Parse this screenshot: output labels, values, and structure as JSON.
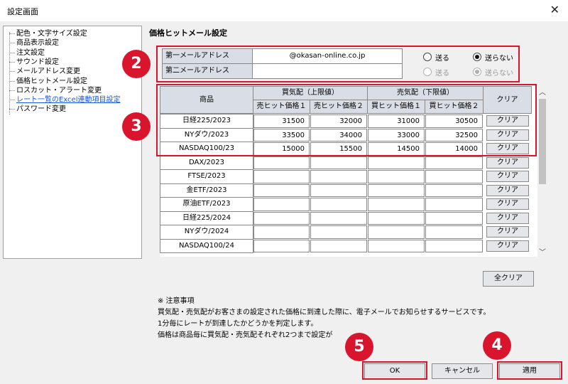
{
  "window": {
    "title": "設定画面",
    "close_glyph": "✕"
  },
  "tree": {
    "items": [
      {
        "label": "配色・文字サイズ設定",
        "link": false
      },
      {
        "label": "商品表示設定",
        "link": false
      },
      {
        "label": "注文設定",
        "link": false
      },
      {
        "label": "サウンド設定",
        "link": false
      },
      {
        "label": "メールアドレス変更",
        "link": false
      },
      {
        "label": "価格ヒットメール設定",
        "link": false
      },
      {
        "label": "ロスカット・アラート変更",
        "link": false
      },
      {
        "label": "レート一覧のExcel連動項目設定",
        "link": true
      },
      {
        "label": "パスワード変更",
        "link": false
      }
    ]
  },
  "section_title": "価格ヒットメール設定",
  "email": {
    "first_label": "第一メールアドレス",
    "first_value": "@okasan-online.co.jp",
    "second_label": "第二メールアドレス",
    "second_value": "",
    "send_label": "送る",
    "nosend_label": "送らない",
    "first_selected": "送らない",
    "second_selected": "送らない"
  },
  "grid": {
    "header_product": "商品",
    "header_buy": "買気配（上限値）",
    "header_sell": "売気配（下限値）",
    "header_clear": "クリア",
    "sub_headers": [
      "売ヒット価格１",
      "売ヒット価格２",
      "買ヒット価格１",
      "買ヒット価格２"
    ],
    "clear_label": "クリア",
    "rows": [
      {
        "product": "日経225/2023",
        "v": [
          "31500",
          "32000",
          "31000",
          "30500"
        ]
      },
      {
        "product": "NYダウ/2023",
        "v": [
          "33500",
          "34000",
          "33000",
          "32500"
        ]
      },
      {
        "product": "NASDAQ100/23",
        "v": [
          "15000",
          "15500",
          "14500",
          "14000"
        ]
      },
      {
        "product": "DAX/2023",
        "v": [
          "",
          "",
          "",
          ""
        ]
      },
      {
        "product": "FTSE/2023",
        "v": [
          "",
          "",
          "",
          ""
        ]
      },
      {
        "product": "金ETF/2023",
        "v": [
          "",
          "",
          "",
          ""
        ]
      },
      {
        "product": "原油ETF/2023",
        "v": [
          "",
          "",
          "",
          ""
        ]
      },
      {
        "product": "日経225/2024",
        "v": [
          "",
          "",
          "",
          ""
        ]
      },
      {
        "product": "NYダウ/2024",
        "v": [
          "",
          "",
          "",
          ""
        ]
      },
      {
        "product": "NASDAQ100/24",
        "v": [
          "",
          "",
          "",
          ""
        ]
      }
    ]
  },
  "all_clear_label": "全クリア",
  "notes": {
    "heading": "※ 注意事項",
    "lines": [
      "買気配・売気配がお客さまの設定された価格に到達した際に、電子メールでお知らせするサービスです。",
      "1分毎にレートが到達したかどうかを判定します。",
      "価格は商品毎に買気配・売気配それぞれ2つまで設定が"
    ]
  },
  "buttons": {
    "ok": "OK",
    "cancel": "キャンセル",
    "apply": "適用"
  },
  "badges": [
    "2",
    "3",
    "4",
    "5"
  ],
  "colors": {
    "accent_red": "#d9152e",
    "header_blue_grey": "#d8dde6",
    "link_blue": "#1a5adb"
  }
}
